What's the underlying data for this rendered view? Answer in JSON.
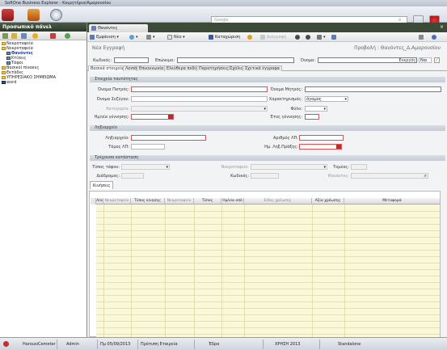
{
  "app": {
    "title": "SoftOne Business Explorer - Κοιμητήρια/Αμαρουσίου"
  },
  "search": {
    "placeholder": "Google"
  },
  "left_panel": {
    "header": "Προσωπικό πάνελ",
    "tree": [
      {
        "label": "Νεκροταφεία",
        "level": 0,
        "selected": false
      },
      {
        "label": "Νεκροταφεία",
        "level": 0,
        "selected": false
      },
      {
        "label": "Θανόντες",
        "level": 1,
        "selected": true
      },
      {
        "label": "Κτίσεις",
        "level": 1,
        "selected": false
      },
      {
        "label": "Τάφοι",
        "level": 1,
        "selected": false
      },
      {
        "label": "Βασικοί πίνακες",
        "level": 0,
        "selected": false
      },
      {
        "label": "Εκτάδες",
        "level": 0,
        "selected": false
      },
      {
        "label": "ΥΠΗΡΕΣΙΑΚΟ ΣΗΜΕΙΩΜΑ",
        "level": 0,
        "selected": false
      },
      {
        "label": "word",
        "level": 0,
        "selected": false
      }
    ]
  },
  "main_tab": {
    "label": "Θανόντες"
  },
  "toolbar": {
    "page_menu": "Εμφάνιση",
    "new": "Νέο",
    "save": "Καταχώριση",
    "delete": "Διαγραφή"
  },
  "header": {
    "left": "Νέα Εγγραφή",
    "right": "Προβολή : Θανόντες_Δ.Αμαρουσίου"
  },
  "fields": {
    "code": "Κωδικός:",
    "surname": "Επώνυμο:",
    "name": "Όνομα:",
    "active": "Ενεργός:",
    "active_value": "Ναι"
  },
  "subtabs": [
    "Βασικά στοιχεία",
    "Λοιπά",
    "Επικοινωνία",
    "Ελεύθερα πεδία",
    "Παρατηρήσεις/Σχόλια",
    "Σχετικά έγγραφα"
  ],
  "section_personal": {
    "title": "Στοιχεία ταυτότητας",
    "father": "Όνομα Πατρός:",
    "mother": "Όνομα Μητρός:",
    "spouse": "Όνομα Συζύγου:",
    "citizenship": "Χαρακτηρισμός:",
    "citizenship_value": "άγαμος",
    "category": "Κατηγορία:",
    "gender": "Φύλο:",
    "birthdate": "Ημ/νία γέννησης:",
    "birthyear": "Έτος γέννησης:"
  },
  "section_registry": {
    "title": "Ληξιαρχείο",
    "registry": "Ληξιαρχείο:",
    "act_no": "Αριθμός ΛΠ:",
    "volume": "Τόμος ΛΠ:",
    "act_date": "Ημ. Ληξ.Πράξης:"
  },
  "section_burial": {
    "title": "Τρέχουσα κατάσταση",
    "grave_type": "Τύπος τάφου:",
    "cemetery": "Νεκροταφείο:",
    "section": "Τομέας:",
    "row": "Διάδρομος:",
    "code": "Κωδικός:",
    "search": "Θανόντες:"
  },
  "grid": {
    "tab": "Κινήσεις",
    "columns": [
      "Α/α",
      "Νεκροταφείο",
      "Τύπος κίνησης",
      "Νεκροταφείο",
      "Τύπος",
      "Ημ/νία από",
      "Είδος χρέωσης",
      "Αξία χρέωσης",
      "Μεταφορά"
    ]
  },
  "status": {
    "user_company": "HarousiCemeter",
    "user": "Admin",
    "date": "Πμ 05/09/2013",
    "branch": "Πρότυπη Εταιρεία",
    "period": "Έδρα",
    "year": "ΧΡΗΣΗ 2013",
    "mode": "Standalone"
  }
}
